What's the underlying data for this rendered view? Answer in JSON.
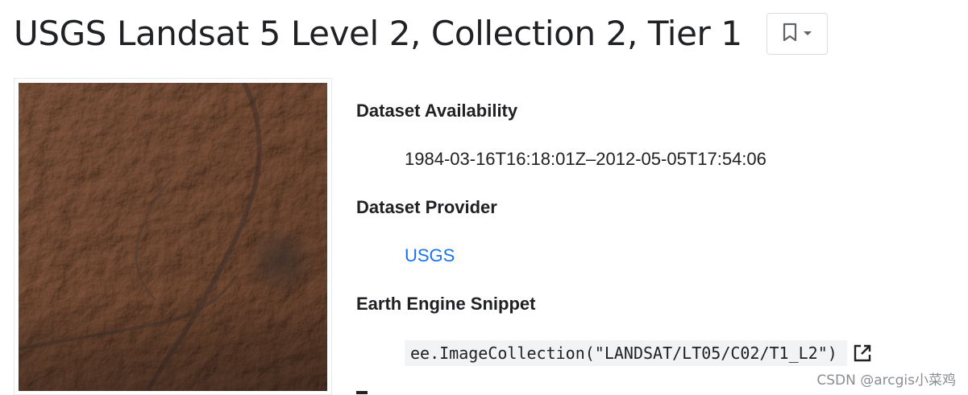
{
  "header": {
    "title": "USGS Landsat 5 Level 2, Collection 2, Tier 1",
    "bookmark_icon": "bookmark-icon",
    "dropdown_icon": "arrow-drop-down-icon"
  },
  "thumbnail": {
    "alt": "Dataset thumbnail: desert terrain satellite imagery",
    "palette": {
      "base": "#8e6e5b",
      "dark": "#4a3a32",
      "light": "#b59a86"
    }
  },
  "metadata": {
    "availability_label": "Dataset Availability",
    "availability_value": "1984-03-16T16:18:01Z–2012-05-05T17:54:06",
    "provider_label": "Dataset Provider",
    "provider_value": "USGS",
    "snippet_label": "Earth Engine Snippet",
    "snippet_value": "ee.ImageCollection(\"LANDSAT/LT05/C02/T1_L2\")",
    "snippet_icon": "open-in-new-icon"
  },
  "watermark": "CSDN @arcgis小菜鸡",
  "colors": {
    "text": "#202124",
    "link": "#1a73e8",
    "code_bg": "#f1f3f4",
    "border": "#dadce0"
  }
}
